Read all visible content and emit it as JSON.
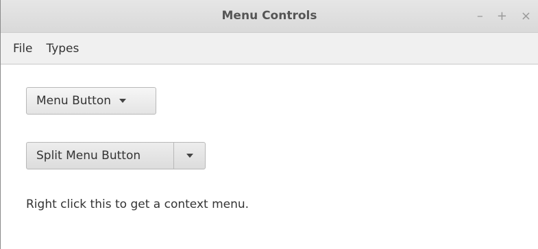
{
  "window": {
    "title": "Menu Controls",
    "controls": {
      "minimize": "–",
      "maximize": "+",
      "close": "×"
    }
  },
  "menubar": {
    "items": [
      {
        "label": "File"
      },
      {
        "label": "Types"
      }
    ]
  },
  "content": {
    "menu_button_label": "Menu Button",
    "split_button_label": "Split Menu Button",
    "context_text": "Right click this to get a context menu."
  },
  "icons": {
    "dropdown": "chevron-down-icon"
  }
}
